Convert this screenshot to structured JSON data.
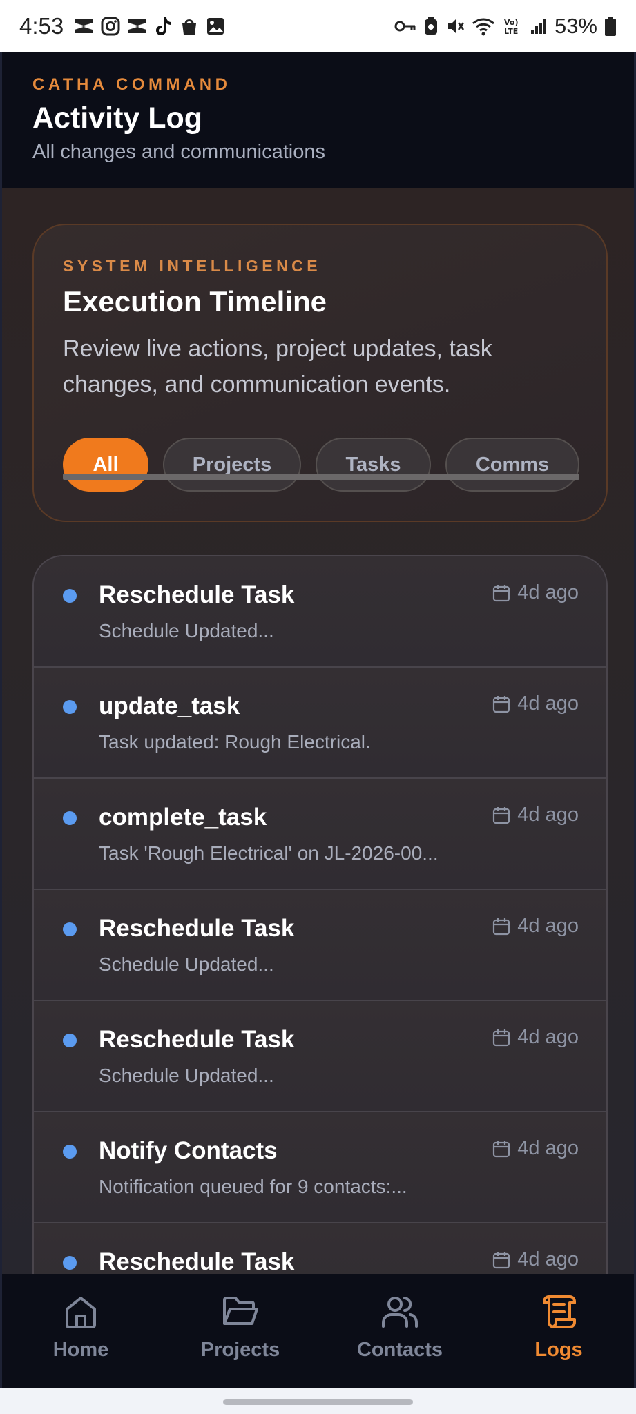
{
  "status_bar": {
    "time": "4:53",
    "battery": "53%"
  },
  "header": {
    "eyebrow": "CATHA COMMAND",
    "title": "Activity Log",
    "subtitle": "All changes and communications"
  },
  "hero": {
    "eyebrow": "SYSTEM INTELLIGENCE",
    "title": "Execution Timeline",
    "description": "Review live actions, project updates, task changes, and communication events.",
    "tabs": [
      {
        "label": "All",
        "active": true
      },
      {
        "label": "Projects",
        "active": false
      },
      {
        "label": "Tasks",
        "active": false
      },
      {
        "label": "Comms",
        "active": false
      }
    ]
  },
  "logs": [
    {
      "title": "Reschedule Task",
      "description": "Schedule Updated...",
      "time": "4d ago"
    },
    {
      "title": "update_task",
      "description": "Task updated: Rough Electrical.",
      "time": "4d ago"
    },
    {
      "title": "complete_task",
      "description": "Task 'Rough Electrical' on JL-2026-00...",
      "time": "4d ago"
    },
    {
      "title": "Reschedule Task",
      "description": "Schedule Updated...",
      "time": "4d ago"
    },
    {
      "title": "Reschedule Task",
      "description": "Schedule Updated...",
      "time": "4d ago"
    },
    {
      "title": "Notify Contacts",
      "description": "Notification queued for 9 contacts:...",
      "time": "4d ago"
    },
    {
      "title": "Reschedule Task",
      "description": "",
      "time": "4d ago"
    }
  ],
  "nav": {
    "items": [
      {
        "label": "Home",
        "icon": "home-icon",
        "active": false
      },
      {
        "label": "Projects",
        "icon": "folder-icon",
        "active": false
      },
      {
        "label": "Contacts",
        "icon": "users-icon",
        "active": false
      },
      {
        "label": "Logs",
        "icon": "scroll-icon",
        "active": true
      }
    ]
  },
  "colors": {
    "accent": "#f07a1d",
    "dot": "#5b9bf0",
    "header_bg": "#0b0d17"
  }
}
